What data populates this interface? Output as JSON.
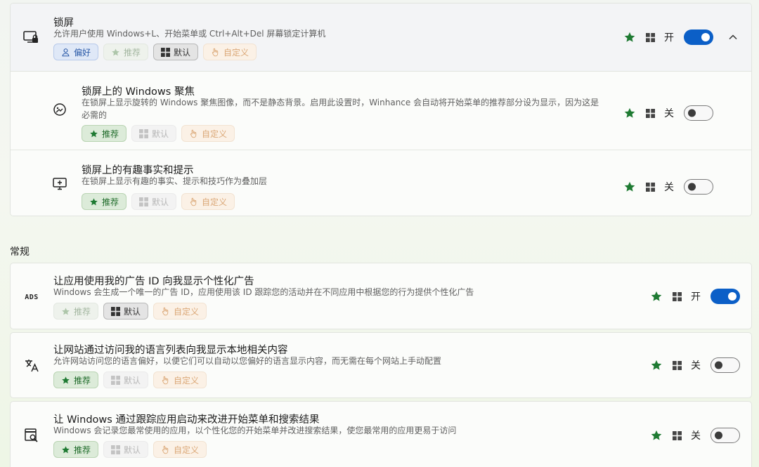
{
  "lockscreen": {
    "title": "锁屏",
    "desc": "允许用户使用 Windows+L、开始菜单或 Ctrl+Alt+Del 屏幕锁定计算机",
    "tags": {
      "preference": "偏好",
      "recommended": "推荐",
      "default": "默认",
      "custom": "自定义"
    },
    "state": "开",
    "toggle_on": true,
    "icon": "monitor-lock-icon",
    "children": [
      {
        "title": "锁屏上的 Windows 聚焦",
        "desc": "在锁屏上显示旋转的 Windows 聚焦图像，而不是静态背景。启用此设置时，Winhance 会自动将开始菜单的推荐部分设为显示，因为这是必需的",
        "tags": {
          "recommended": "推荐",
          "default": "默认",
          "custom": "自定义"
        },
        "state": "关",
        "toggle_on": false,
        "icon": "spotlight-icon"
      },
      {
        "title": "锁屏上的有趣事实和提示",
        "desc": "在锁屏上显示有趣的事实、提示和技巧作为叠加层",
        "tags": {
          "recommended": "推荐",
          "default": "默认",
          "custom": "自定义"
        },
        "state": "关",
        "toggle_on": false,
        "icon": "monitor-tips-icon"
      }
    ]
  },
  "general": {
    "title": "常规",
    "items": [
      {
        "title": "让应用使用我的广告 ID 向我显示个性化广告",
        "desc": "Windows 会生成一个唯一的广告 ID，应用使用该 ID 跟踪您的活动并在不同应用中根据您的行为提供个性化广告",
        "tags": {
          "recommended": "推荐",
          "default": "默认",
          "custom": "自定义"
        },
        "state": "开",
        "toggle_on": true,
        "icon": "ads-icon",
        "icon_text": "ADS"
      },
      {
        "title": "让网站通过访问我的语言列表向我显示本地相关内容",
        "desc": "允许网站访问您的语言偏好，以便它们可以自动以您偏好的语言显示内容，而无需在每个网站上手动配置",
        "tags": {
          "recommended": "推荐",
          "default": "默认",
          "custom": "自定义"
        },
        "state": "关",
        "toggle_on": false,
        "icon": "translate-icon"
      },
      {
        "title": "让 Windows 通过跟踪应用启动来改进开始菜单和搜索结果",
        "desc": "Windows 会记录您最常使用的应用，以个性化您的开始菜单并改进搜索结果，使您最常用的应用更易于访问",
        "tags": {
          "recommended": "推荐",
          "default": "默认",
          "custom": "自定义"
        },
        "state": "关",
        "toggle_on": false,
        "icon": "app-search-icon"
      }
    ]
  }
}
